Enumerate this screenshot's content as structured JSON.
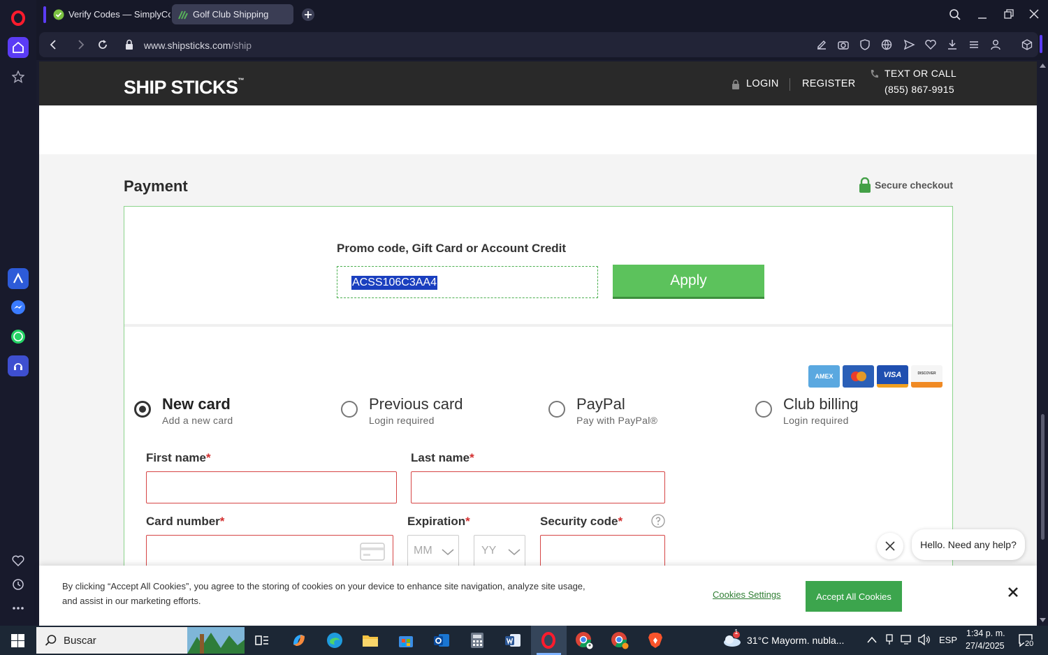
{
  "browser": {
    "tabs": [
      {
        "label": "Verify Codes — SimplyCodes",
        "active": false
      },
      {
        "label": "Golf Club Shipping",
        "active": true
      }
    ],
    "url_host": "www.shipsticks.com",
    "url_path": "/ship"
  },
  "site": {
    "logo": "SHIP STICKS",
    "login": "LOGIN",
    "register": "REGISTER",
    "contact_label": "TEXT OR CALL",
    "phone": "(855) 867-9915"
  },
  "payment": {
    "title": "Payment",
    "secure": "Secure checkout",
    "promo_label": "Promo code, Gift Card or Account Credit",
    "promo_value": "ACSS106C3AA4",
    "apply": "Apply",
    "card_brands": [
      "AMEX",
      "",
      "VISA",
      "DISCOVER"
    ],
    "options": [
      {
        "title": "New card",
        "subtitle": "Add a new card",
        "selected": true
      },
      {
        "title": "Previous card",
        "subtitle": "Login required",
        "selected": false
      },
      {
        "title": "PayPal",
        "subtitle": "Pay with PayPal®",
        "selected": false
      },
      {
        "title": "Club billing",
        "subtitle": "Login required",
        "selected": false
      }
    ],
    "fields": {
      "first_name": "First name",
      "last_name": "Last name",
      "card_number": "Card number",
      "expiration": "Expiration",
      "security_code": "Security code",
      "required_mark": "*",
      "mm_placeholder": "MM",
      "yy_placeholder": "YY"
    }
  },
  "cookie": {
    "text": "By clicking “Accept All Cookies”, you agree to the storing of cookies on your device to enhance site navigation, analyze site usage, and assist in our marketing efforts.",
    "settings": "Cookies Settings",
    "accept": "Accept All Cookies"
  },
  "chat": {
    "message": "Hello. Need any help?"
  },
  "taskbar": {
    "search": "Buscar",
    "weather": "31°C  Mayorm. nubla...",
    "weather_badge": "1",
    "language": "ESP",
    "time": "1:34 p. m.",
    "date": "27/4/2025",
    "notifications": "20"
  },
  "colors": {
    "accent_green": "#5cc25c",
    "error_red": "#d64545",
    "header_dark": "#292929"
  }
}
